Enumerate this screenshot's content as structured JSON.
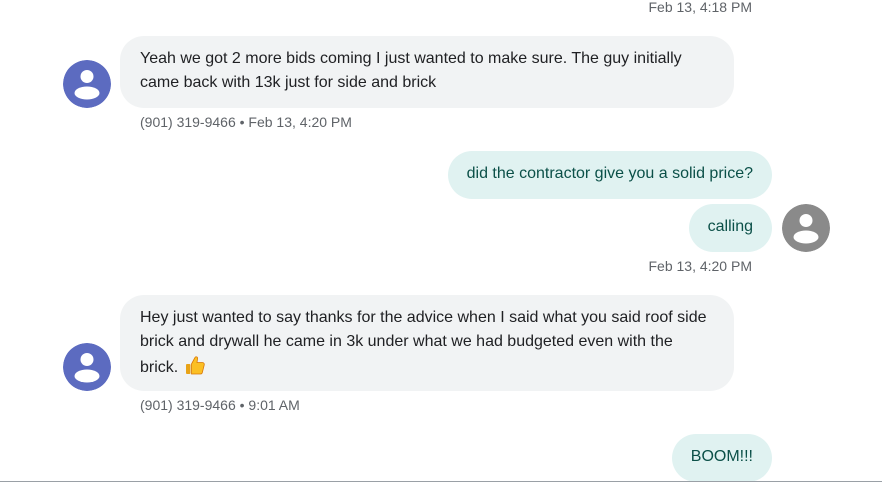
{
  "colors": {
    "incoming_avatar": "#5c6bc0",
    "outgoing_avatar": "#8a8a8a",
    "incoming_bubble": "#f1f3f4",
    "outgoing_bubble": "#e0f2f1",
    "outgoing_text": "#0b5048"
  },
  "messages": [
    {
      "direction": "out",
      "timestamp": "Feb 13, 4:18 PM"
    },
    {
      "direction": "in",
      "avatar_icon": "person-icon",
      "text": "Yeah we got 2 more bids coming I just wanted to make sure. The guy initially came back with 13k just for side and brick",
      "meta": "(901) 319-9466 • Feb 13, 4:20 PM"
    },
    {
      "direction": "out",
      "text": "did the contractor give you a solid price?"
    },
    {
      "direction": "out",
      "text": "calling",
      "avatar_icon": "person-icon",
      "timestamp": "Feb 13, 4:20 PM"
    },
    {
      "direction": "in",
      "avatar_icon": "person-icon",
      "text": "Hey just wanted to say thanks for the advice when I said what you said roof side brick and drywall he came in 3k under what we had budgeted even with the brick.",
      "emoji_icon": "thumbs-up-icon",
      "meta": "(901) 319-9466 • 9:01 AM"
    },
    {
      "direction": "out",
      "text": "BOOM!!!"
    }
  ]
}
